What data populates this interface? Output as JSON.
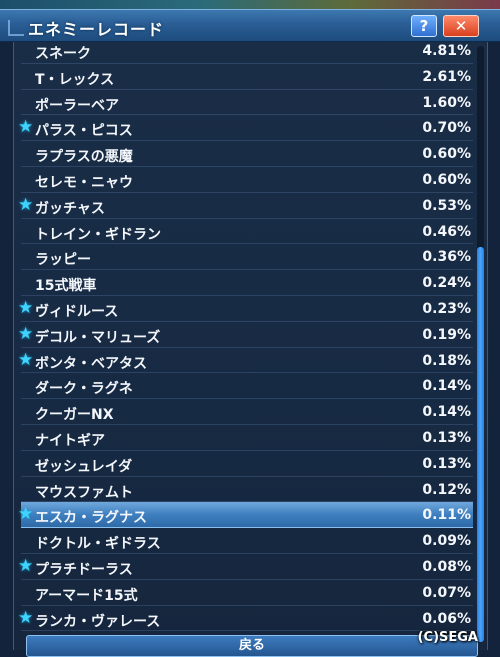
{
  "window": {
    "title": "エネミーレコード",
    "help_label": "?",
    "close_label": "✕"
  },
  "records": [
    {
      "name": "スネーク",
      "rate": "4.81%",
      "star": false
    },
    {
      "name": "T・レックス",
      "rate": "2.61%",
      "star": false
    },
    {
      "name": "ポーラーベア",
      "rate": "1.60%",
      "star": false
    },
    {
      "name": "パラス・ピコス",
      "rate": "0.70%",
      "star": true
    },
    {
      "name": "ラプラスの悪魔",
      "rate": "0.60%",
      "star": false
    },
    {
      "name": "セレモ・ニャウ",
      "rate": "0.60%",
      "star": false
    },
    {
      "name": "ガッチャス",
      "rate": "0.53%",
      "star": true
    },
    {
      "name": "トレイン・ギドラン",
      "rate": "0.46%",
      "star": false
    },
    {
      "name": "ラッピー",
      "rate": "0.36%",
      "star": false
    },
    {
      "name": "15式戦車",
      "rate": "0.24%",
      "star": false
    },
    {
      "name": "ヴィドルース",
      "rate": "0.23%",
      "star": true
    },
    {
      "name": "デコル・マリューズ",
      "rate": "0.19%",
      "star": true
    },
    {
      "name": "ボンタ・ベアタス",
      "rate": "0.18%",
      "star": true
    },
    {
      "name": "ダーク・ラグネ",
      "rate": "0.14%",
      "star": false
    },
    {
      "name": "クーガーNX",
      "rate": "0.14%",
      "star": false
    },
    {
      "name": "ナイトギア",
      "rate": "0.13%",
      "star": false
    },
    {
      "name": "ゼッシュレイダ",
      "rate": "0.13%",
      "star": false
    },
    {
      "name": "マウスファムト",
      "rate": "0.12%",
      "star": false
    },
    {
      "name": "エスカ・ラグナス",
      "rate": "0.11%",
      "star": true,
      "selected": true
    },
    {
      "name": "ドクトル・ギドラス",
      "rate": "0.09%",
      "star": false
    },
    {
      "name": "プラチドーラス",
      "rate": "0.08%",
      "star": true
    },
    {
      "name": "アーマード15式",
      "rate": "0.07%",
      "star": false
    },
    {
      "name": "ランカ・ヴァレース",
      "rate": "0.06%",
      "star": true
    }
  ],
  "footer": {
    "back_label": "戻る",
    "copyright": "(C)SEGA"
  },
  "colors": {
    "accent": "#3fd4ff",
    "selected_row": "#3f7fbf"
  }
}
